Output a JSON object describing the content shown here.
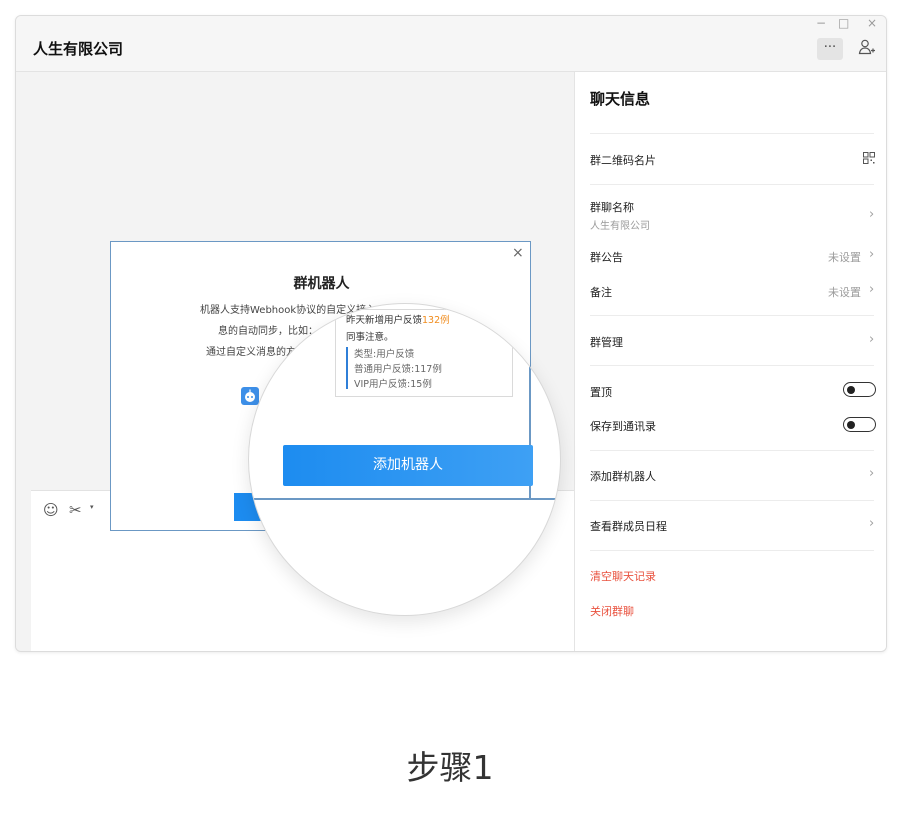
{
  "window": {
    "title": "人生有限公司",
    "controls": {
      "minimize": "−",
      "maximize": "□",
      "close": "×"
    },
    "more_label": "···",
    "add_member_icon": "person-plus-icon"
  },
  "toolbar": {
    "emoji_glyph": "☺",
    "scissors_glyph": "✂",
    "caret_glyph": "▾"
  },
  "panel": {
    "title": "聊天信息",
    "rows": [
      {
        "label": "群二维码名片"
      },
      {
        "label": "群聊名称",
        "sub": "人生有限公司"
      },
      {
        "label": "群公告",
        "value": "未设置"
      },
      {
        "label": "备注",
        "value": "未设置"
      },
      {
        "label": "群管理"
      },
      {
        "label": "置顶"
      },
      {
        "label": "保存到通讯录"
      },
      {
        "label": "添加群机器人"
      },
      {
        "label": "查看群成员日程"
      }
    ],
    "danger": [
      "清空聊天记录",
      "关闭群聊"
    ],
    "chevron": "›",
    "accent_red": "#e9523f"
  },
  "dialog": {
    "close": "×",
    "title": "群机器人",
    "desc_line1": "机器人支持Webhook协议的自定义接入，实现信",
    "desc_line2": "息的自动同步，比如：",
    "desc_line3": "通过自定义消息的方",
    "button_color": "#1d8cf0"
  },
  "magnifier": {
    "bubble_line1_a": "昨天新增用户反馈",
    "bubble_line1_b": "132例",
    "bubble_line2": "同事注意。",
    "bubble_line3": "类型:用户反馈",
    "bubble_line4": "普通用户反馈:117例",
    "bubble_line5": "VIP用户反馈:15例",
    "button_label": "添加机器人"
  },
  "caption": "步骤1"
}
